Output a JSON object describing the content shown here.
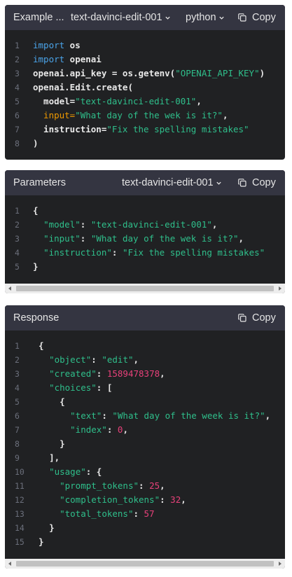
{
  "example": {
    "title": "Example ...",
    "model_select": "text-davinci-edit-001",
    "language_select": "python",
    "copy_label": "Copy",
    "lines": [
      {
        "n": "1"
      },
      {
        "n": "2"
      },
      {
        "n": "3"
      },
      {
        "n": "4"
      },
      {
        "n": "5"
      },
      {
        "n": "6"
      },
      {
        "n": "7"
      },
      {
        "n": "8"
      }
    ],
    "code": {
      "l1_kw": "import",
      "l1_rest": " os",
      "l2_kw": "import",
      "l2_rest": " openai",
      "l3_a": "openai.api_key = os.getenv(",
      "l3_str": "\"OPENAI_API_KEY\"",
      "l3_b": ")",
      "l4": "openai.Edit.create(",
      "l5_a": "  model=",
      "l5_str": "\"text-davinci-edit-001\"",
      "l5_b": ",",
      "l6_attr": "  input=",
      "l6_str": "\"What day of the wek is it?\"",
      "l6_b": ",",
      "l7_a": "  instruction=",
      "l7_str": "\"Fix the spelling mistakes\"",
      "l8": ")"
    }
  },
  "parameters": {
    "title": "Parameters",
    "model_select": "text-davinci-edit-001",
    "copy_label": "Copy",
    "code": {
      "l1": "{",
      "l2_key": "\"model\"",
      "l2_sep": ": ",
      "l2_val": "\"text-davinci-edit-001\"",
      "l2_end": ",",
      "l3_key": "\"input\"",
      "l3_sep": ": ",
      "l3_val": "\"What day of the wek is it?\"",
      "l3_end": ",",
      "l4_key": "\"instruction\"",
      "l4_sep": ": ",
      "l4_val": "\"Fix the spelling mistakes\"",
      "l5": "}"
    }
  },
  "response": {
    "title": "Response",
    "copy_label": "Copy",
    "code": {
      "l1": "{",
      "l2_key": "\"object\"",
      "l2_val": "\"edit\"",
      "l3_key": "\"created\"",
      "l3_val": "1589478378",
      "l4_key": "\"choices\"",
      "l4_rest": ": [",
      "l5": "{",
      "l6_key": "\"text\"",
      "l6_val": "\"What day of the week is it?\"",
      "l7_key": "\"index\"",
      "l7_val": "0",
      "l8": "}",
      "l9": "],",
      "l10_key": "\"usage\"",
      "l10_rest": ": {",
      "l11_key": "\"prompt_tokens\"",
      "l11_val": "25",
      "l12_key": "\"completion_tokens\"",
      "l12_val": "32",
      "l13_key": "\"total_tokens\"",
      "l13_val": "57",
      "l14": "}",
      "l15": "}"
    }
  },
  "icons": [
    "copy-icon",
    "chevron-down-icon"
  ]
}
